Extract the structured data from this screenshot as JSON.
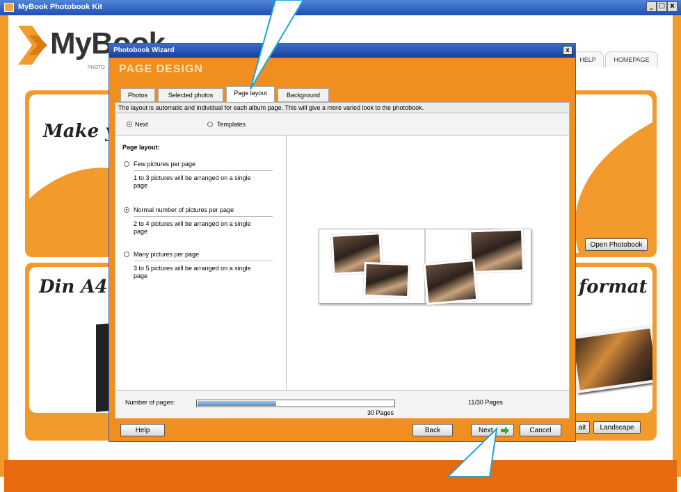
{
  "app": {
    "title": "MyBook Photobook Kit",
    "window_buttons": [
      "_",
      "□",
      "x"
    ]
  },
  "logo": {
    "text": "MyBook",
    "subtitle": "PHOTO"
  },
  "top_nav": {
    "help": "HELP",
    "homepage": "HOMEPAGE"
  },
  "background": {
    "panel1_text": "Make you",
    "panel2_left_text": "Din A4",
    "panel2_right_text": "format",
    "open_photobook": "Open Photobook",
    "landscape": "Landscape",
    "portrait_partial": "ait"
  },
  "wizard": {
    "title": "Photobook Wizard",
    "close": "x",
    "heading": "PAGE DESIGN",
    "tabs": [
      {
        "label": "Photos"
      },
      {
        "label": "Selected photos"
      },
      {
        "label": "Page layout"
      },
      {
        "label": "Background"
      }
    ],
    "info": "The layout is automatic and individual for each album page. This will give a more varied look to the photobook.",
    "mode": {
      "next": "Next",
      "templates": "Templates"
    },
    "page_layout_label": "Page layout:",
    "layout_options": [
      {
        "label": "Few pictures per page",
        "desc": "1 to 3 pictures will be arranged on a single page"
      },
      {
        "label": "Normal number of pictures per page",
        "desc": "2 to 4 pictures will be arranged on a single page"
      },
      {
        "label": "Many pictures per page",
        "desc": "3 to 5 pictures will be arranged on a single page"
      }
    ],
    "pages": {
      "label": "Number of pages:",
      "progress": 0.4,
      "count_text": "11/30 Pages",
      "total_text": "30 Pages"
    },
    "buttons": {
      "help": "Help",
      "back": "Back",
      "next": "Next",
      "cancel": "Cancel"
    }
  },
  "colors": {
    "accent": "#f19a2a",
    "deep_orange": "#e86a0f",
    "title_blue": "#1f4fb4",
    "callout": "#1aa6d6"
  }
}
